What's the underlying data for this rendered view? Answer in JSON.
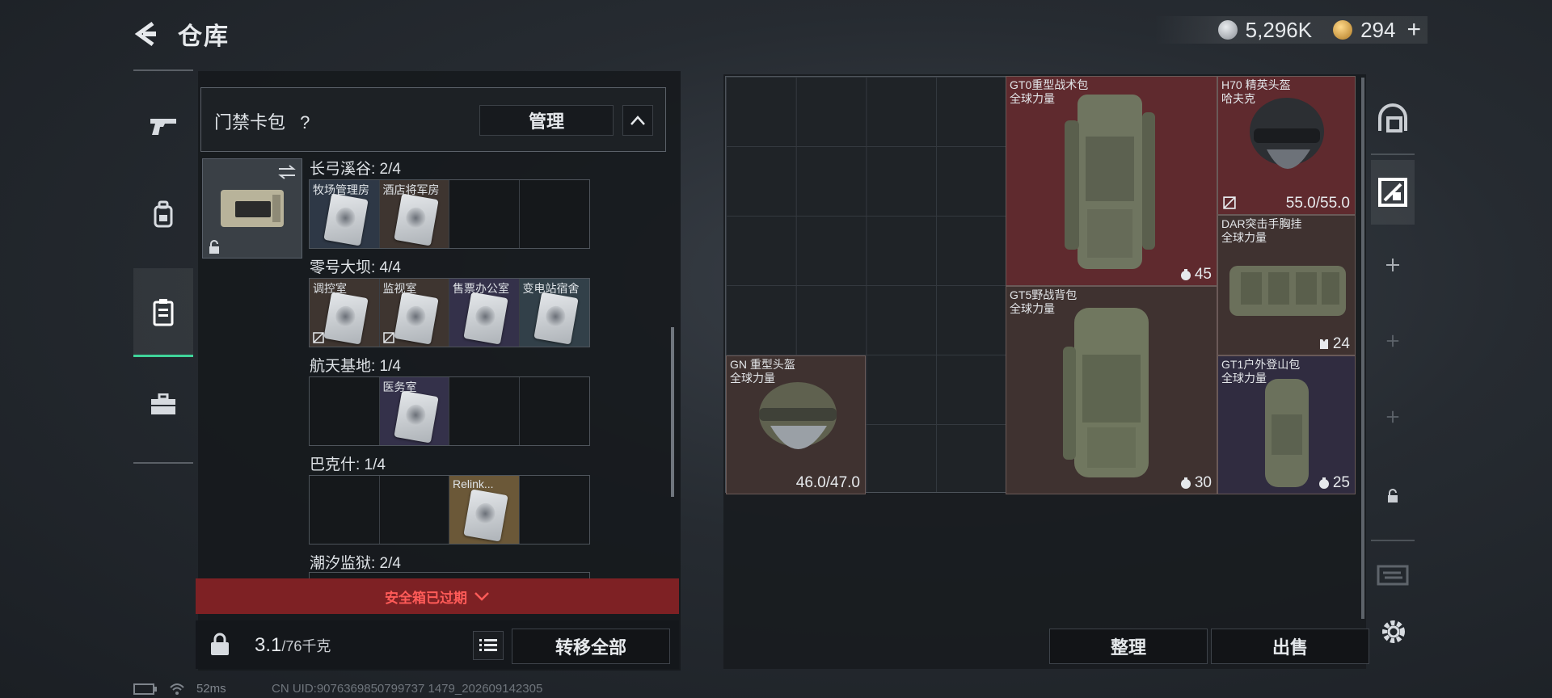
{
  "header": {
    "title": "仓库",
    "currency_primary": "5,296K",
    "currency_secondary": "294",
    "plus_label": "+"
  },
  "colors": {
    "accent_green": "#3fd49a",
    "expired_red": "#ff5b58",
    "item_red_bg": "#5f2a2e"
  },
  "left_rail": {
    "items": [
      {
        "name": "weapons",
        "icon": "gun-icon"
      },
      {
        "name": "gear",
        "icon": "backpack-icon"
      },
      {
        "name": "keycard-case",
        "icon": "keycard-case-icon",
        "active": true
      },
      {
        "name": "toolbox",
        "icon": "briefcase-icon"
      }
    ]
  },
  "card_case": {
    "title": "门禁卡包",
    "help": "?",
    "manage_label": "管理",
    "groups": [
      {
        "label": "长弓溪谷: 2/4",
        "slots": [
          {
            "name": "牧场管理房",
            "color": "blue",
            "broken": false
          },
          {
            "name": "酒店将军房",
            "color": "brown",
            "broken": false
          },
          null,
          null
        ]
      },
      {
        "label": "零号大坝: 4/4",
        "slots": [
          {
            "name": "调控室",
            "color": "brown",
            "broken": true
          },
          {
            "name": "监视室",
            "color": "brown",
            "broken": true
          },
          {
            "name": "售票办公室",
            "color": "purple",
            "broken": false
          },
          {
            "name": "变电站宿舍",
            "color": "cyan",
            "broken": false
          }
        ]
      },
      {
        "label": "航天基地: 1/4",
        "slots": [
          null,
          {
            "name": "医务室",
            "color": "purple",
            "broken": false
          },
          null,
          null
        ]
      },
      {
        "label": "巴克什: 1/4",
        "slots": [
          null,
          null,
          {
            "name": "Relink...",
            "color": "gold",
            "broken": false
          },
          null
        ]
      },
      {
        "label": "潮汐监狱: 2/4",
        "slots": []
      }
    ],
    "expired_notice": "安全箱已过期",
    "weight_current": "3.1",
    "weight_max": "/76千克",
    "transfer_all_label": "转移全部"
  },
  "stash": {
    "items": [
      {
        "name": "GT0重型战术包",
        "sub": "全球力量",
        "stat": "45",
        "stat_type": "capacity",
        "color": "red"
      },
      {
        "name": "H70 精英头盔",
        "sub": "哈夫克",
        "stat": "55.0/55.0",
        "stat_type": "durability",
        "color": "red"
      },
      {
        "name": "DAR突击手胸挂",
        "sub": "全球力量",
        "stat": "24",
        "stat_type": "capacity",
        "color": "brown"
      },
      {
        "name": "GT5野战背包",
        "sub": "全球力量",
        "stat": "30",
        "stat_type": "capacity",
        "color": "brown"
      },
      {
        "name": "GN 重型头盔",
        "sub": "全球力量",
        "stat": "46.0/47.0",
        "stat_type": "durability",
        "color": "brown"
      },
      {
        "name": "GT1户外登山包",
        "sub": "全球力量",
        "stat": "25",
        "stat_type": "capacity",
        "color": "purple"
      }
    ],
    "sort_label": "整理",
    "sell_label": "出售"
  },
  "right_rail": {
    "items": [
      "helmet-slot-icon",
      "stash-tab-icon",
      "add-icon",
      "add-icon",
      "add-icon",
      "lock-icon",
      "exchange-icon",
      "gear-icon"
    ]
  },
  "status": {
    "ping": "52ms",
    "uid": "CN UID:9076369850799737 1479_202609142305"
  }
}
